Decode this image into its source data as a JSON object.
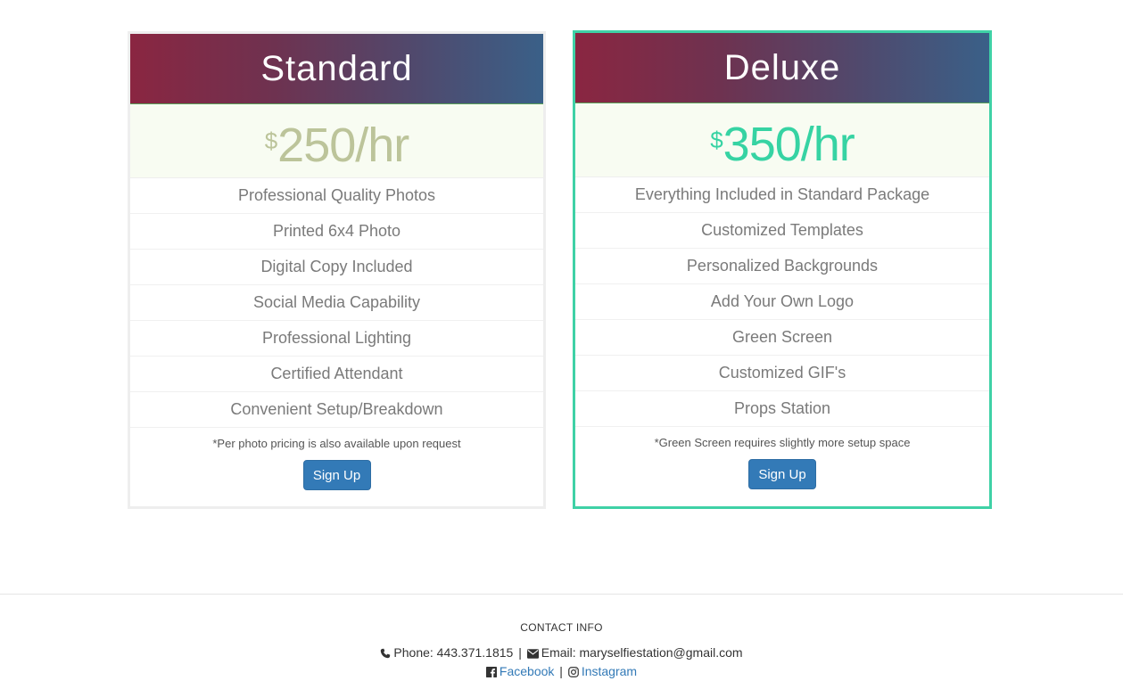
{
  "plans": [
    {
      "name": "Standard",
      "currency": "$",
      "price": "250/hr",
      "features": [
        "Professional Quality Photos",
        "Printed 6x4 Photo",
        "Digital Copy Included",
        "Social Media Capability",
        "Professional Lighting",
        "Certified Attendant",
        "Convenient Setup/Breakdown"
      ],
      "note": "*Per photo pricing is also available upon request",
      "button": "Sign Up"
    },
    {
      "name": "Deluxe",
      "currency": "$",
      "price": "350/hr",
      "features": [
        "Everything Included in Standard Package",
        "Customized Templates",
        "Personalized Backgrounds",
        "Add Your Own Logo",
        "Green Screen",
        "Customized GIF's",
        "Props Station"
      ],
      "note": "*Green Screen requires slightly more setup space",
      "button": "Sign Up"
    }
  ],
  "footer": {
    "title": "CONTACT INFO",
    "phone": "Phone: 443.371.1815",
    "separator": "|",
    "email": "Email: maryselfiestation@gmail.com",
    "facebook": "Facebook",
    "instagram": "Instagram",
    "icons": [
      "phone-icon",
      "envelope-icon",
      "facebook-icon",
      "instagram-icon"
    ]
  },
  "colors": {
    "header_gradient_start": "#8a2641",
    "header_gradient_end": "#3a6088",
    "deluxe_accent": "#3fd1a6",
    "standard_price": "#bcc49a",
    "button": "#337ab7",
    "link": "#337ab7"
  }
}
